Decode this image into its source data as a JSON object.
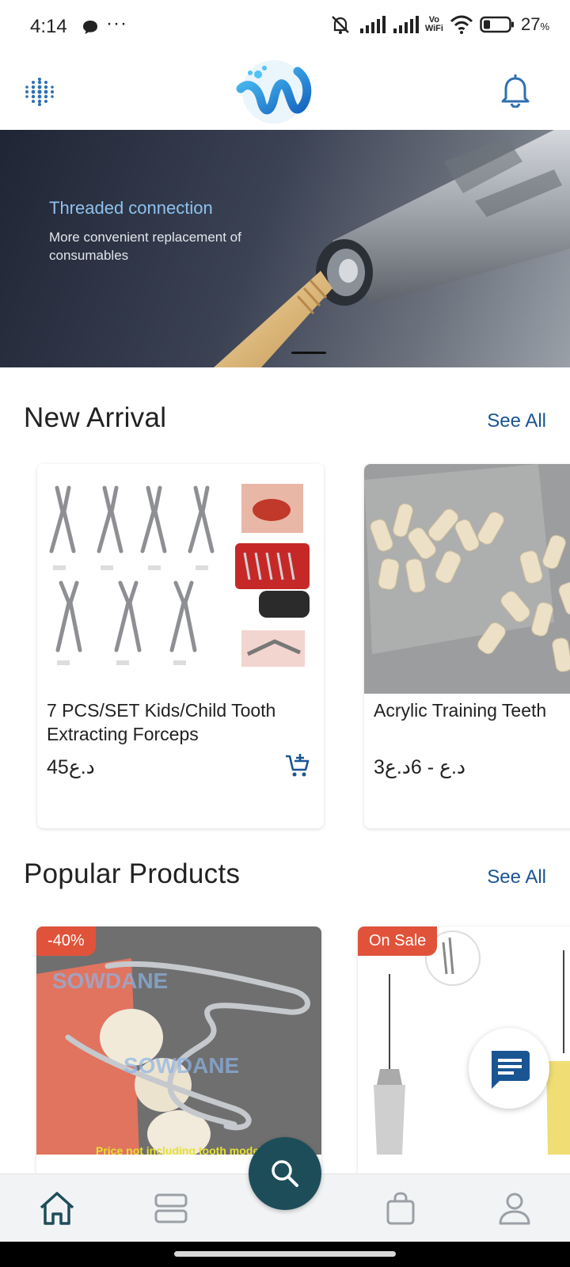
{
  "status_bar": {
    "time": "4:14",
    "more": "···",
    "vowifi": "Vo\nWiFi",
    "battery": "27",
    "battery_unit": "%"
  },
  "header": {
    "menu_icon": "grid-dots-icon",
    "logo": "w-logo",
    "bell_icon": "bell-icon"
  },
  "banner": {
    "title": "Threaded connection",
    "subtitle": "More convenient replacement of consumables"
  },
  "new_arrival": {
    "title": "New Arrival",
    "see_all": "See All",
    "products": [
      {
        "name": "7 PCS/SET Kids/Child Tooth Extracting Forceps",
        "price": "45د.ع"
      },
      {
        "name": "Acrylic Training Teeth",
        "price": "3د.ع - 6د.ع"
      }
    ]
  },
  "popular_products": {
    "title": "Popular Products",
    "see_all": "See All",
    "products": [
      {
        "badge": "-40%",
        "watermark": "SOWDANE",
        "caption": "Price not including tooth model"
      },
      {
        "badge": "On Sale"
      }
    ]
  },
  "bottom_nav": {
    "items": [
      "home-icon",
      "categories-icon",
      "search-icon",
      "bag-icon",
      "account-icon"
    ]
  },
  "colors": {
    "accent": "#1a5593",
    "nav_fab": "#1e4d5a",
    "badge": "#e0533a"
  }
}
